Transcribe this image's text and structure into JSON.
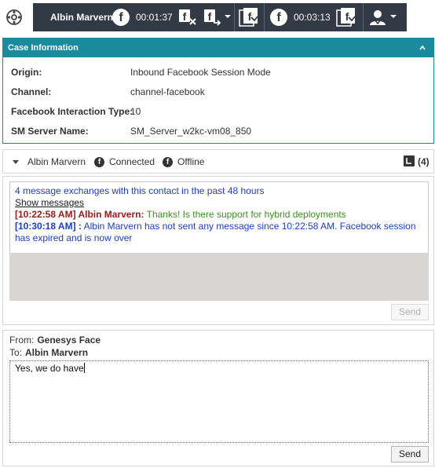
{
  "toolbar": {
    "app_icon": "workspace-icon",
    "agent_name": "Albin Marvern",
    "timer_1": "00:01:37",
    "timer_2": "00:03:13",
    "icons": [
      "facebook-icon",
      "end-chat-icon",
      "transfer-icon",
      "done-icon",
      "facebook-icon",
      "done-icon",
      "party-actions-icon"
    ]
  },
  "case_info": {
    "title": "Case Information",
    "rows": [
      {
        "label": "Origin:",
        "value": "Inbound Facebook Session Mode"
      },
      {
        "label": "Channel:",
        "value": "channel-facebook"
      },
      {
        "label": "Facebook Interaction Type:",
        "value": "10"
      },
      {
        "label": "SM Server Name:",
        "value": "SM_Server_w2kc-vm08_850"
      }
    ]
  },
  "participants": {
    "name": "Albin Marvern",
    "status_1": "Connected",
    "status_2": "Offline",
    "history_count": "(4)"
  },
  "transcript": {
    "summary": "4 message exchanges with this contact in the past 48 hours",
    "show_messages": "Show messages",
    "msg1_time_name": "[10:22:58 AM] Albin Marvern:",
    "msg1_text": "Thanks! Is there support for hybrid deployments",
    "msg2_time": "[10:30:18 AM] :",
    "msg2_text_line1": "Albin Marvern has not sent any message since 10:22:58 AM. Facebook session",
    "msg2_text_line2": "has expired and is now over"
  },
  "reply_area": {
    "send_label": "Send"
  },
  "compose": {
    "from_label": "From:",
    "from_value": "Genesys Face",
    "to_label": "To:",
    "to_value": "Albin Marvern",
    "text": "Yes, we do have",
    "send_label": "Send"
  },
  "colors": {
    "toolbar_bg": "#323a45",
    "case_header": "#1b8a9c",
    "link_blue": "#1f3ec6",
    "agent_red": "#9b1b1b",
    "message_green": "#3d8f1f"
  }
}
